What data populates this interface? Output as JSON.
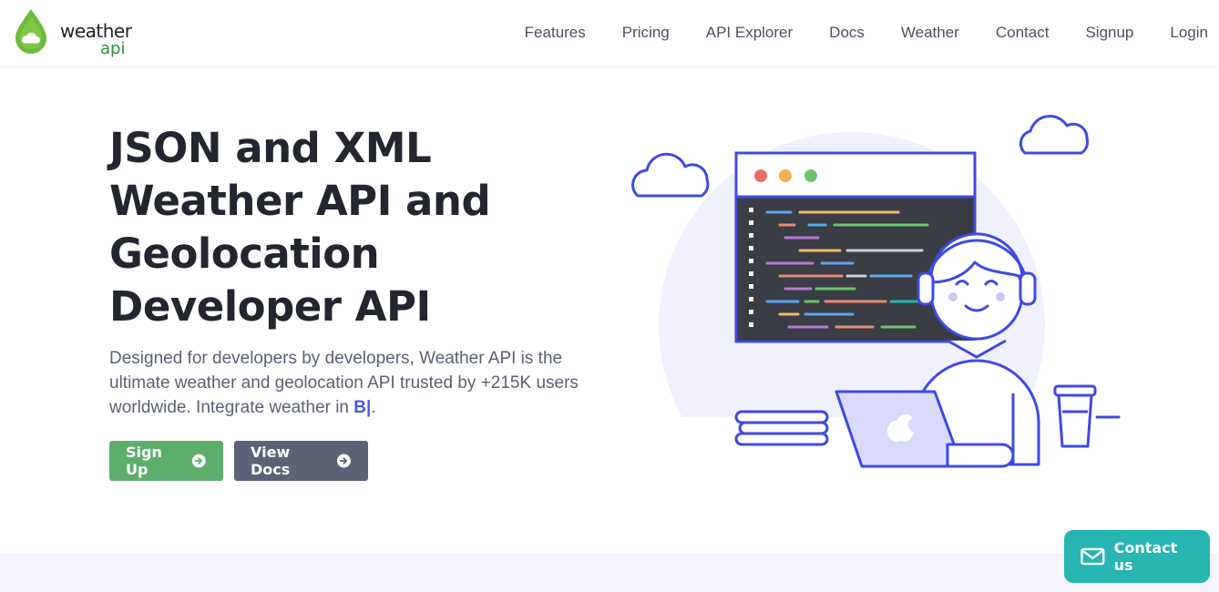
{
  "brand": {
    "line1": "weather",
    "line2": "api",
    "color_leaf": "#5fb33b",
    "color_word_api": "#2f8f3a"
  },
  "nav": [
    {
      "label": "Features"
    },
    {
      "label": "Pricing"
    },
    {
      "label": "API Explorer"
    },
    {
      "label": "Docs"
    },
    {
      "label": "Weather"
    },
    {
      "label": "Contact"
    },
    {
      "label": "Signup"
    },
    {
      "label": "Login"
    }
  ],
  "hero": {
    "title_lines": [
      "JSON and XML",
      "Weather API and",
      "Geolocation",
      "Developer API"
    ],
    "description": "Designed for developers by developers, Weather API is the ultimate weather and geolocation API trusted by +215K users worldwide. Integrate weather in",
    "typed_text": "B|",
    "description_end": ".",
    "buttons": {
      "signup": {
        "label": "Sign Up",
        "icon": "arrow-circle-right-icon",
        "color": "#5dae6d"
      },
      "docs": {
        "label": "View Docs",
        "icon": "arrow-circle-right-icon",
        "color": "#5c6377"
      }
    }
  },
  "illustration": {
    "icons": [
      "cloud-icon",
      "code-window-icon",
      "developer-with-headphones",
      "laptop-icon",
      "coffee-cup-icon",
      "books-icon"
    ],
    "accent_color": "#3f4ae0"
  },
  "contact_widget": {
    "label": "Contact us",
    "icon": "envelope-icon",
    "color": "#27b5b1"
  }
}
